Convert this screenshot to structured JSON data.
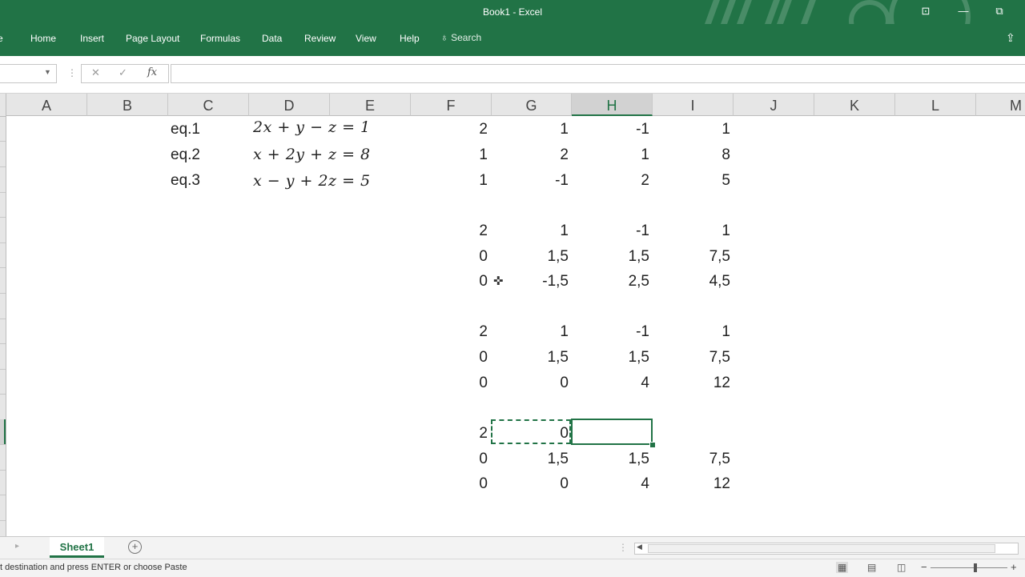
{
  "titlebar": {
    "title": "Book1  -  Excel",
    "ribbon_options_icon": "ribbon-display-icon",
    "minimize_icon": "minimize-icon",
    "restore_icon": "restore-icon"
  },
  "ribbon": {
    "tabs": [
      "e",
      "Home",
      "Insert",
      "Page Layout",
      "Formulas",
      "Data",
      "Review",
      "View",
      "Help"
    ],
    "search_label": "Search",
    "share_icon": "share-icon"
  },
  "formula_bar": {
    "name_box": "",
    "cancel_icon": "✕",
    "enter_icon": "✓",
    "fx_label": "fx",
    "formula": ""
  },
  "columns": [
    "A",
    "B",
    "C",
    "D",
    "E",
    "F",
    "G",
    "H",
    "I",
    "J",
    "K",
    "L",
    "M"
  ],
  "active_column": "H",
  "equation_labels": [
    "eq.1",
    "eq.2",
    "eq.3"
  ],
  "equations": [
    "2x + y − z = 1",
    "x + 2y + z = 8",
    "x − y + 2z = 5"
  ],
  "matrices": [
    [
      [
        "2",
        "1",
        "-1",
        "1"
      ],
      [
        "1",
        "2",
        "1",
        "8"
      ],
      [
        "1",
        "-1",
        "2",
        "5"
      ]
    ],
    [
      [
        "2",
        "1",
        "-1",
        "1"
      ],
      [
        "0",
        "1,5",
        "1,5",
        "7,5"
      ],
      [
        "0",
        "-1,5",
        "2,5",
        "4,5"
      ]
    ],
    [
      [
        "2",
        "1",
        "-1",
        "1"
      ],
      [
        "0",
        "1,5",
        "1,5",
        "7,5"
      ],
      [
        "0",
        "0",
        "4",
        "12"
      ]
    ],
    [
      [
        "2",
        "0",
        "",
        ""
      ],
      [
        "0",
        "1,5",
        "1,5",
        "7,5"
      ],
      [
        "0",
        "0",
        "4",
        "12"
      ]
    ]
  ],
  "sheets": {
    "active": "Sheet1",
    "add_icon": "+"
  },
  "status": {
    "message": "Select destination and press ENTER or choose Paste",
    "visible_message": "t destination and press ENTER or choose Paste",
    "zoom_minus": "−",
    "zoom_plus": "+"
  }
}
